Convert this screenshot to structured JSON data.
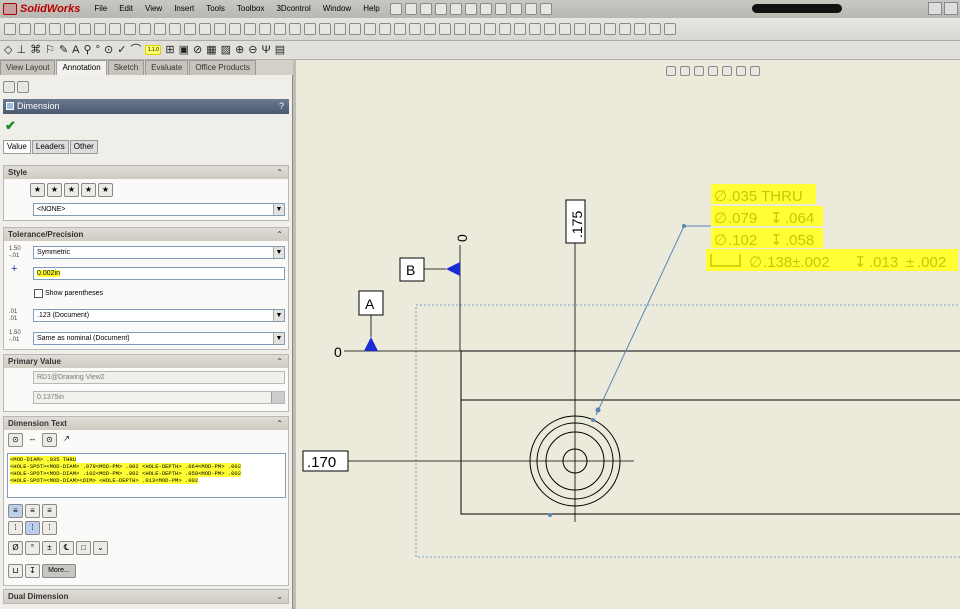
{
  "app": {
    "title": "SolidWorks"
  },
  "menu": [
    "File",
    "Edit",
    "View",
    "Insert",
    "Tools",
    "Toolbox",
    "3Dcontrol",
    "Window",
    "Help"
  ],
  "command_tabs": [
    {
      "label": "View Layout"
    },
    {
      "label": "Annotation",
      "active": true
    },
    {
      "label": "Sketch"
    },
    {
      "label": "Evaluate"
    },
    {
      "label": "Office Products"
    }
  ],
  "toolbar3_highlight": "1.1.0",
  "property_manager": {
    "title": "Dimension",
    "help": "?",
    "subtabs": [
      "Value",
      "Leaders",
      "Other"
    ],
    "style": {
      "header": "Style",
      "value": "<NONE>"
    },
    "tolerance": {
      "header": "Tolerance/Precision",
      "type": "Symmetric",
      "plus_value": "0.002in",
      "show_parentheses": "Show parentheses",
      "precision": ".123 (Document)",
      "tol_precision": "Same as nominal (Document)"
    },
    "primary_value": {
      "header": "Primary Value",
      "reference": "RD1@Drawing View2",
      "value": "0.1375in"
    },
    "dimension_text": {
      "header": "Dimension Text",
      "lines": [
        "<MOD-DIAM> .035 THRU",
        "<HOLE-SPOT><MOD-DIAM> .079<MOD-PM> .002  <HOLE-DEPTH> .064<MOD-PM> .002",
        "<HOLE-SPOT><MOD-DIAM> .102<MOD-PM> .002  <HOLE-DEPTH> .058<MOD-PM> .002",
        "<HOLE-SPOT><MOD-DIAM><DIM>  <HOLE-DEPTH> .013<MOD-PM> .002"
      ],
      "more_label": "More..."
    },
    "dual_dimension": {
      "header": "Dual Dimension"
    }
  },
  "drawing": {
    "datum_a": "A",
    "datum_b": "B",
    "zero_left": "0",
    "zero_top": "0",
    "dim_vertical": ".175",
    "dim_horizontal": ".170",
    "callout": [
      ".035 THRU",
      ".079",
      ".064",
      ".102",
      ".058",
      ".138±.002",
      ".013",
      ".002"
    ]
  },
  "colors": {
    "highlight": "#ffff33",
    "datum_blue": "#1a2bd6",
    "title_bar": "#4a5870"
  }
}
